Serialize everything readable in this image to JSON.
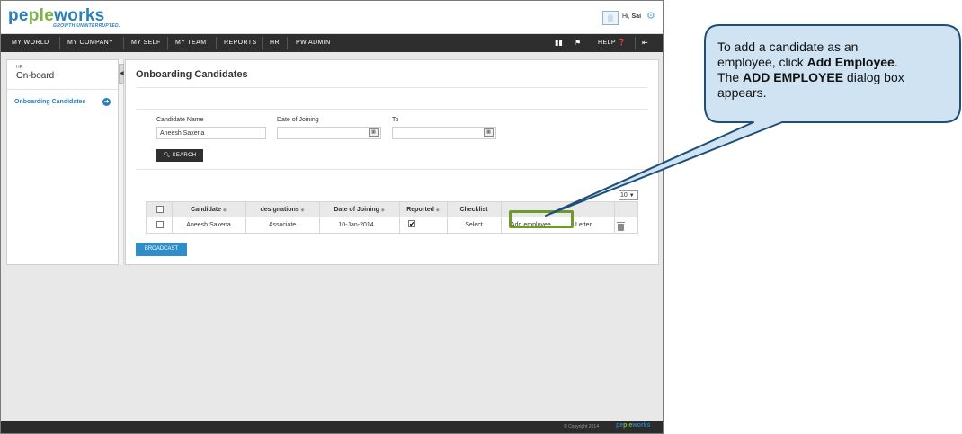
{
  "app": {
    "logo_part1": "pe",
    "logo_part2": "ple",
    "logo_part3": "works",
    "tagline": "GROWTH.UNINTERRUPTED.",
    "greeting_prefix": "Hi,",
    "user_name": "Sai"
  },
  "nav": {
    "items": [
      "MY WORLD",
      "MY COMPANY",
      "MY SELF",
      "MY TEAM",
      "REPORTS",
      "HR",
      "PW ADMIN"
    ],
    "help_label": "HELP"
  },
  "sidebar": {
    "section_small": "HR",
    "section_title": "On-board",
    "items": [
      {
        "label": "Onboarding Candidates"
      }
    ]
  },
  "main": {
    "title": "Onboarding Candidates",
    "form": {
      "candidate_name_label": "Candidate Name",
      "candidate_name_value": "Aneesh  Saxena",
      "date_of_joining_label": "Date of Joining",
      "to_label": "To",
      "search_label": "SEARCH"
    },
    "page_size": "10",
    "table": {
      "headers": [
        "Candidate",
        "designations",
        "Date of Joining",
        "Reported",
        "Checklist"
      ],
      "rows": [
        {
          "candidate": "Aneesh Saxena",
          "designation": "Associate",
          "date_of_joining": "10-Jan-2014",
          "reported": true,
          "checklist": "Select",
          "add_employee": "Add employee",
          "letter": "Letter"
        }
      ]
    },
    "broadcast_label": "BROADCAST"
  },
  "footer": {
    "copyright": "© Copyright 2014"
  },
  "callout": {
    "line1": "To add a candidate as an",
    "line2_pre": "employee, click ",
    "line2_bold": "Add Employee",
    "line2_post": ".",
    "line3_pre": "The ",
    "line3_bold": "ADD EMPLOYEE",
    "line3_post": " dialog box",
    "line4": "appears."
  },
  "colors": {
    "brand_blue": "#2a7fb8",
    "brand_green": "#7cb342",
    "nav_bg": "#2e2e2e",
    "highlight": "#6d9a2a",
    "callout_fill": "#cfe3f3",
    "callout_border": "#1f4f78"
  }
}
